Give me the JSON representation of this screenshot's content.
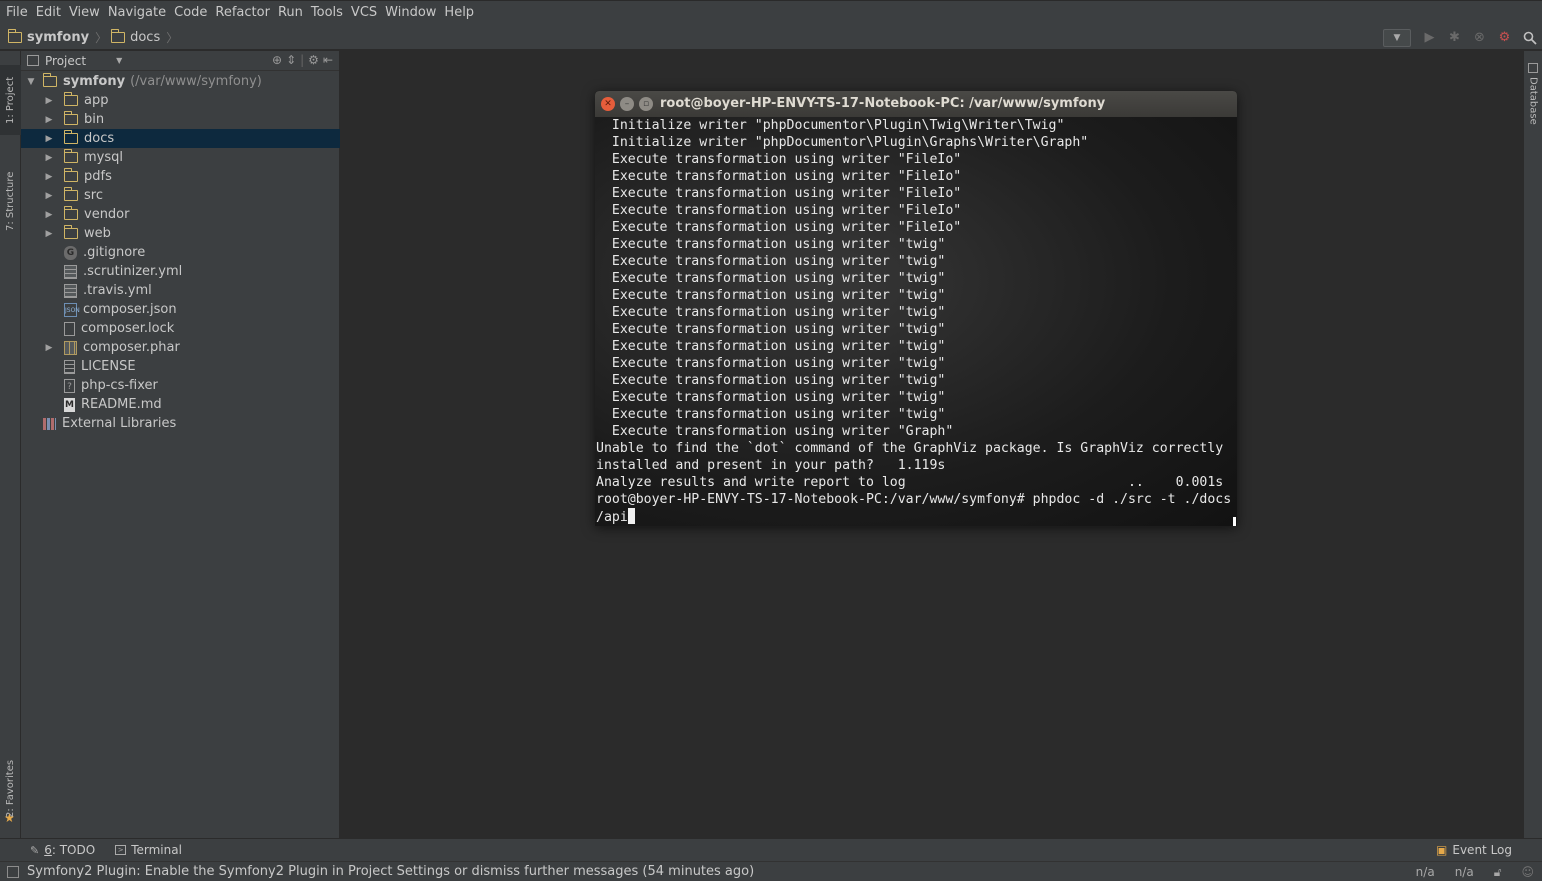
{
  "menu": [
    "File",
    "Edit",
    "View",
    "Navigate",
    "Code",
    "Refactor",
    "Run",
    "Tools",
    "VCS",
    "Window",
    "Help"
  ],
  "breadcrumb": {
    "root": "symfony",
    "child": "docs"
  },
  "left_tabs": {
    "project": "1: Project",
    "structure": "7: Structure",
    "favorites": "2: Favorites"
  },
  "right_tabs": {
    "database": "Database"
  },
  "project_panel": {
    "title": "Project",
    "root_name": "symfony",
    "root_path": "(/var/www/symfony)",
    "items": [
      {
        "label": "app",
        "type": "folder"
      },
      {
        "label": "bin",
        "type": "folder"
      },
      {
        "label": "docs",
        "type": "folder"
      },
      {
        "label": "mysql",
        "type": "folder"
      },
      {
        "label": "pdfs",
        "type": "folder"
      },
      {
        "label": "src",
        "type": "folder"
      },
      {
        "label": "vendor",
        "type": "folder"
      },
      {
        "label": "web",
        "type": "folder"
      },
      {
        "label": ".gitignore",
        "type": "git-file"
      },
      {
        "label": ".scrutinizer.yml",
        "type": "yml-file"
      },
      {
        "label": ".travis.yml",
        "type": "yml-file"
      },
      {
        "label": "composer.json",
        "type": "json-file"
      },
      {
        "label": "composer.lock",
        "type": "text-file"
      },
      {
        "label": "composer.phar",
        "type": "archive-file"
      },
      {
        "label": "LICENSE",
        "type": "text-file"
      },
      {
        "label": "php-cs-fixer",
        "type": "unknown-file"
      },
      {
        "label": "README.md",
        "type": "markdown-file"
      }
    ],
    "external": "External Libraries"
  },
  "terminal": {
    "title": "root@boyer-HP-ENVY-TS-17-Notebook-PC: /var/www/symfony",
    "lines": [
      "  Initialize writer \"phpDocumentor\\Plugin\\Twig\\Writer\\Twig\"",
      "  Initialize writer \"phpDocumentor\\Plugin\\Graphs\\Writer\\Graph\"",
      "  Execute transformation using writer \"FileIo\"",
      "  Execute transformation using writer \"FileIo\"",
      "  Execute transformation using writer \"FileIo\"",
      "  Execute transformation using writer \"FileIo\"",
      "  Execute transformation using writer \"FileIo\"",
      "  Execute transformation using writer \"twig\"",
      "  Execute transformation using writer \"twig\"",
      "  Execute transformation using writer \"twig\"",
      "  Execute transformation using writer \"twig\"",
      "  Execute transformation using writer \"twig\"",
      "  Execute transformation using writer \"twig\"",
      "  Execute transformation using writer \"twig\"",
      "  Execute transformation using writer \"twig\"",
      "  Execute transformation using writer \"twig\"",
      "  Execute transformation using writer \"twig\"",
      "  Execute transformation using writer \"twig\"",
      "  Execute transformation using writer \"Graph\"",
      "Unable to find the `dot` command of the GraphViz package. Is GraphViz correctly",
      "installed and present in your path?   1.119s",
      "Analyze results and write report to log                            ..    0.001s",
      "root@boyer-HP-ENVY-TS-17-Notebook-PC:/var/www/symfony# phpdoc -d ./src -t ./docs"
    ],
    "prompt_tail": "/api"
  },
  "bottom_tabs": {
    "todo_number": "6",
    "todo": ": TODO",
    "terminal": "Terminal",
    "event_log": "Event Log"
  },
  "status": {
    "message": "Symfony2 Plugin: Enable the Symfony2 Plugin in Project Settings or dismiss further messages (54 minutes ago)",
    "pos1": "n/a",
    "pos2": "n/a"
  },
  "colors": {
    "folder": "#d0b565",
    "selection": "#0d293e",
    "close_button": "#e65d3b"
  }
}
